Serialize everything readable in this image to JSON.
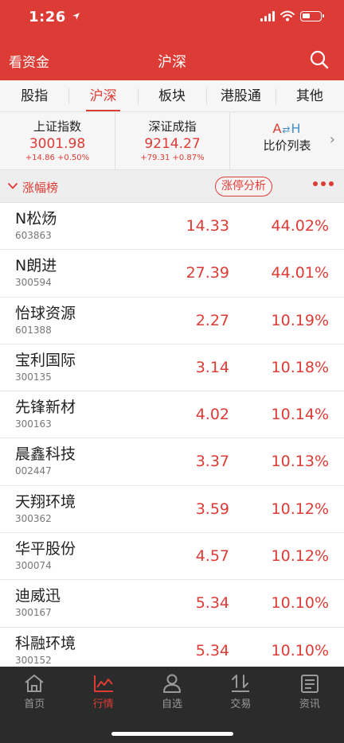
{
  "status_bar": {
    "time": "1:26"
  },
  "header": {
    "left_label": "看资金",
    "title": "沪深"
  },
  "tabs": [
    {
      "label": "股指",
      "active": false
    },
    {
      "label": "沪深",
      "active": true
    },
    {
      "label": "板块",
      "active": false
    },
    {
      "label": "港股通",
      "active": false
    },
    {
      "label": "其他",
      "active": false
    }
  ],
  "indices": [
    {
      "name": "上证指数",
      "value": "3001.98",
      "change": "+14.86",
      "pct": "+0.50%"
    },
    {
      "name": "深证成指",
      "value": "9214.27",
      "change": "+79.31",
      "pct": "+0.87%"
    }
  ],
  "ah": {
    "logo_a": "A",
    "logo_h": "H",
    "label": "比价列表"
  },
  "section": {
    "title": "涨幅榜",
    "limit_up_button": "涨停分析"
  },
  "stocks": [
    {
      "name": "N松炀",
      "code": "603863",
      "price": "14.33",
      "change": "44.02%"
    },
    {
      "name": "N朗进",
      "code": "300594",
      "price": "27.39",
      "change": "44.01%"
    },
    {
      "name": "怡球资源",
      "code": "601388",
      "price": "2.27",
      "change": "10.19%"
    },
    {
      "name": "宝利国际",
      "code": "300135",
      "price": "3.14",
      "change": "10.18%"
    },
    {
      "name": "先锋新材",
      "code": "300163",
      "price": "4.02",
      "change": "10.14%"
    },
    {
      "name": "晨鑫科技",
      "code": "002447",
      "price": "3.37",
      "change": "10.13%"
    },
    {
      "name": "天翔环境",
      "code": "300362",
      "price": "3.59",
      "change": "10.12%"
    },
    {
      "name": "华平股份",
      "code": "300074",
      "price": "4.57",
      "change": "10.12%"
    },
    {
      "name": "迪威迅",
      "code": "300167",
      "price": "5.34",
      "change": "10.10%"
    },
    {
      "name": "科融环境",
      "code": "300152",
      "price": "5.34",
      "change": "10.10%"
    }
  ],
  "bottom_nav": [
    {
      "label": "首页",
      "icon": "home-icon",
      "active": false
    },
    {
      "label": "行情",
      "icon": "chart-icon",
      "active": true
    },
    {
      "label": "自选",
      "icon": "person-icon",
      "active": false
    },
    {
      "label": "交易",
      "icon": "trade-arrows-icon",
      "active": false
    },
    {
      "label": "资讯",
      "icon": "news-icon",
      "active": false
    }
  ],
  "colors": {
    "brand_red": "#dd3b35",
    "nav_bg": "#2b2b2b"
  }
}
